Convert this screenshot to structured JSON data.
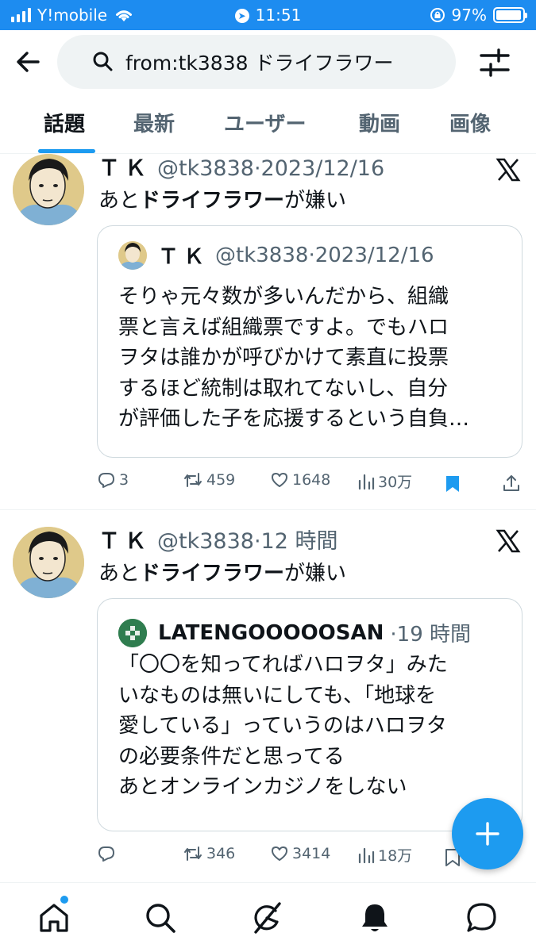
{
  "status_bar": {
    "carrier": "Y!mobile",
    "time": "11:51",
    "battery": "97%",
    "battery_fraction": 0.97
  },
  "search": {
    "query": "from:tk3838 ドライフラワー"
  },
  "tabs": [
    {
      "label": "話題",
      "active": true
    },
    {
      "label": "最新",
      "active": false
    },
    {
      "label": "ユーザー",
      "active": false
    },
    {
      "label": "動画",
      "active": false
    },
    {
      "label": "画像",
      "active": false
    }
  ],
  "tweets": [
    {
      "name": "ＴＫ",
      "handle": "@tk3838",
      "time": "2023/12/16",
      "text_before": "あと",
      "text_bold": "ドライフラワー",
      "text_after": "が嫌い",
      "quote": {
        "name": "ＴＫ",
        "handle": "@tk3838",
        "time": "2023/12/16",
        "lines": [
          "そりゃ元々数が多いんだから、組織",
          "票と言えば組織票ですよ。でもハロ",
          "ヲタは誰かが呼びかけて素直に投票",
          "するほど統制は取れてないし、自分",
          "が評価した子を応援するという自負…"
        ]
      },
      "replies": "3",
      "retweets": "459",
      "likes": "1648",
      "views": "30万",
      "bookmarked": true
    },
    {
      "name": "ＴＫ",
      "handle": "@tk3838",
      "time": "12 時間",
      "text_before": "あと",
      "text_bold": "ドライフラワー",
      "text_after": "が嫌い",
      "quote": {
        "name": "LATENGOOOOOSAN",
        "handle": "",
        "time": "19 時間",
        "lines": [
          "「〇〇を知ってればハロヲタ」みた",
          "いなものは無いにしても、「地球を",
          "愛している」っていうのはハロヲタ",
          "の必要条件だと思ってる",
          "あとオンラインカジノをしない"
        ]
      },
      "replies": "",
      "retweets": "346",
      "likes": "3414",
      "views": "18万",
      "bookmarked": false
    }
  ],
  "colors": {
    "accent": "#1d9bf0",
    "status_bar": "#1d8cf0",
    "text": "#0f1419",
    "secondary": "#536471"
  },
  "icons": {
    "back": "arrow-left-icon",
    "filter": "filter-icon",
    "home": "home-icon",
    "search": "search-icon",
    "grok": "grok-icon",
    "notifications": "bell-icon",
    "messages": "message-icon"
  }
}
